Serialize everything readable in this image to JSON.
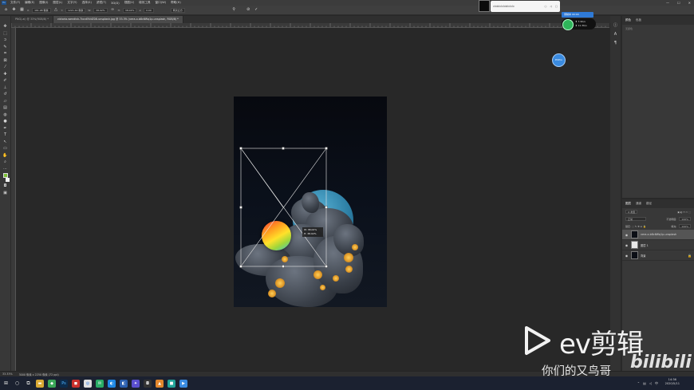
{
  "menubar": {
    "app_icon": "Ps",
    "items": [
      "文件(F)",
      "编辑(E)",
      "图像(I)",
      "图层(L)",
      "文字(Y)",
      "选择(S)",
      "滤镜(T)",
      "3D(D)",
      "视图(V)",
      "增效工具",
      "窗口(W)",
      "帮助(H)"
    ],
    "win_controls": [
      "—",
      "☐",
      "✕"
    ]
  },
  "options": {
    "x_label": "X:",
    "x_value": "161.98 像素",
    "y_label": "Y:",
    "y_value": "1221.44 像素",
    "w_label": "W:",
    "w_value": "38.02%",
    "h_label": "H:",
    "h_value": "38.02%",
    "angle_label": "∠",
    "angle_value": "0.00",
    "interp_value": "两次立方",
    "cancel_icon": "⊘",
    "commit_icon": "✓"
  },
  "tabs": [
    {
      "label": "PNG(.ai) @ 33%(RGB/8) *",
      "active": false
    },
    {
      "label": "victoria-wendish-7ixcd5VdZ08-unsplash.jpg @ 33.3% (vera-x-b8c6Wq1p-unsplash, RGB/8) *",
      "active": true
    }
  ],
  "transform_readout": {
    "line1": "W: 38.02%",
    "line2": "H: 38.02%"
  },
  "right_panel": {
    "tabs": [
      "颜色",
      "色板"
    ],
    "hint": "无颜色"
  },
  "layers_panel": {
    "tabs": [
      "图层",
      "通道",
      "路径"
    ],
    "filter_label": "Q 类型",
    "blend_mode": "正常",
    "opacity_label": "不透明度:",
    "opacity_value": "100%",
    "fill_label": "填充:",
    "fill_value": "100%",
    "layers": [
      {
        "name": "vera-x-b8c6Wq1p-unsplash",
        "selected": true,
        "thumb": "dark"
      },
      {
        "name": "图层 1",
        "selected": false,
        "thumb": "white"
      },
      {
        "name": "背景",
        "selected": false,
        "thumb": "dark",
        "locked": true
      }
    ]
  },
  "status": {
    "zoom": "33.33%",
    "doc": "3000 像素 x 2250 像素 (72 ppi)"
  },
  "taskbar": {
    "start_icon": "windows-icon",
    "clock_time": "14:36",
    "clock_date": "2020/5/11",
    "tray_lang": "中"
  },
  "overlays": {
    "audio_widget_text": "ıılıılıılıılıılıılıılıılıılıı",
    "float_bubble_text": "EVPro",
    "green_tag": "录制中 00:00",
    "green_line1": "⬆ 7.9K/s",
    "green_line2": "⬇ 11.3K/s"
  },
  "watermark": {
    "brand": "ev剪辑",
    "caption": "你们的又鸟哥",
    "bili": "bilibili"
  },
  "colors": {
    "foreground": "#7bbf36",
    "background": "#f2f2f2",
    "canvas": "#282828",
    "accent": "#2f7ad6"
  }
}
